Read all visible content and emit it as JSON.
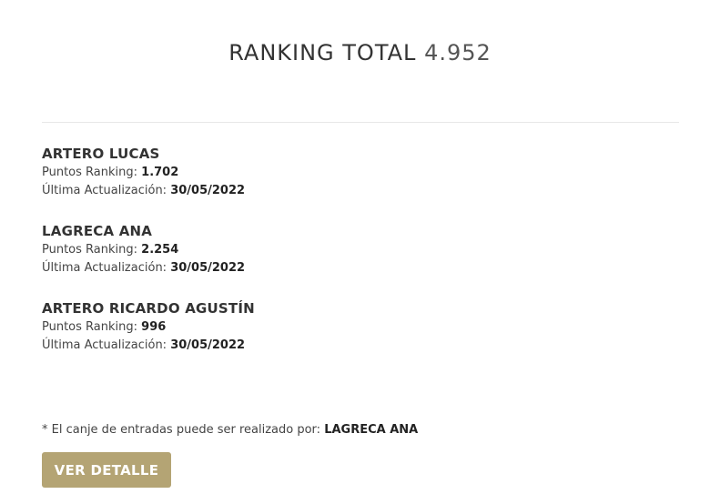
{
  "ranking": {
    "title_label": "RANKING TOTAL",
    "total": "4.952"
  },
  "members": [
    {
      "name": "ARTERO LUCAS",
      "points_label": "Puntos Ranking:",
      "points": "1.702",
      "updated_label": "Última Actualización:",
      "updated": "30/05/2022"
    },
    {
      "name": "LAGRECA ANA",
      "points_label": "Puntos Ranking:",
      "points": "2.254",
      "updated_label": "Última Actualización:",
      "updated": "30/05/2022"
    },
    {
      "name": "ARTERO RICARDO AGUSTÍN",
      "points_label": "Puntos Ranking:",
      "points": "996",
      "updated_label": "Última Actualización:",
      "updated": "30/05/2022"
    }
  ],
  "note": {
    "text": "* El canje de entradas puede ser realizado por:",
    "name": "LAGRECA ANA"
  },
  "actions": {
    "detail_label": "VER DETALLE"
  },
  "colors": {
    "button_bg": "#b4a474",
    "text": "#333333"
  }
}
